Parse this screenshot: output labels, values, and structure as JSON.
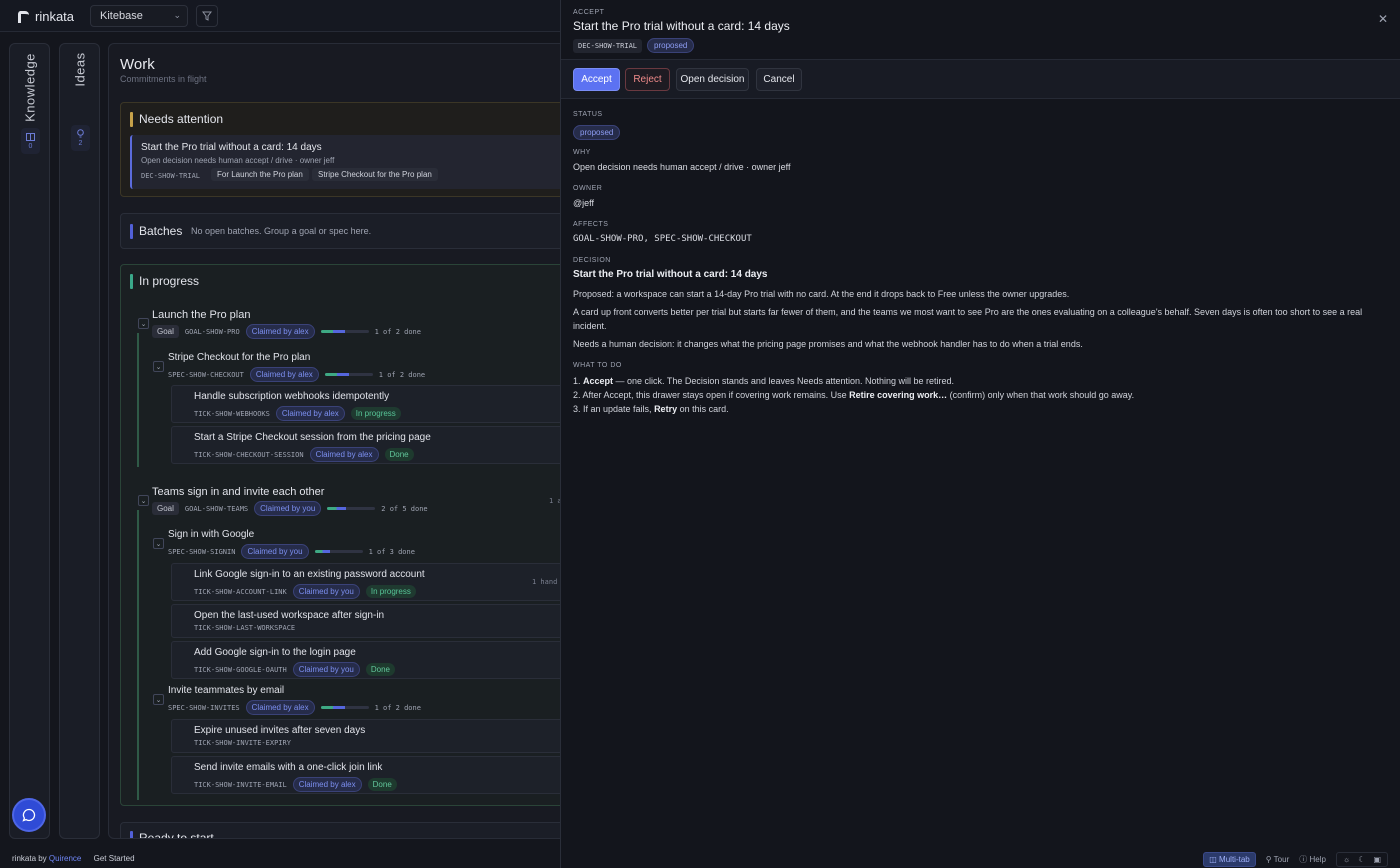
{
  "app": {
    "name": "rinkata",
    "workspace": "Kitebase"
  },
  "rails": {
    "knowledge": {
      "label": "Knowledge",
      "count": "0"
    },
    "ideas": {
      "label": "Ideas",
      "count": "2"
    }
  },
  "work": {
    "title": "Work",
    "subtitle": "Commitments in flight",
    "needs_attention": {
      "heading": "Needs attention",
      "card": {
        "title": "Start the Pro trial without a card: 14 days",
        "subtitle": "Open decision needs human accept / drive · owner jeff",
        "code": "DEC-SHOW-TRIAL",
        "chip_goal": "For Launch the Pro plan",
        "chip_spec": "Stripe Checkout for the Pro plan"
      }
    },
    "batches": {
      "heading": "Batches",
      "text": "No open batches. Group a goal or spec here."
    },
    "in_progress": {
      "heading": "In progress",
      "goal1": {
        "title": "Launch the Pro plan",
        "type": "Goal",
        "code": "GOAL-SHOW-PRO",
        "claim": "Claimed by alex",
        "progress_text": "1 of 2 done",
        "progress": 0.5,
        "spec": {
          "title": "Stripe Checkout for the Pro plan",
          "code": "SPEC-SHOW-CHECKOUT",
          "claim": "Claimed by alex",
          "progress_text": "1 of 2 done",
          "progress": 0.5,
          "t1": {
            "title": "Handle subscription webhooks idempotently",
            "code": "TICK-SHOW-WEBHOOKS",
            "claim": "Claimed by alex",
            "status": "In progress"
          },
          "t2": {
            "title": "Start a Stripe Checkout session from the pricing page",
            "code": "TICK-SHOW-CHECKOUT-SESSION",
            "claim": "Claimed by alex",
            "status": "Done"
          }
        }
      },
      "goal2": {
        "title": "Teams sign in and invite each other",
        "type": "Goal",
        "code": "GOAL-SHOW-TEAMS",
        "claim": "Claimed by you",
        "progress_text": "2 of 5 done",
        "progress": 0.4,
        "side": "1 a",
        "spec1": {
          "title": "Sign in with Google",
          "code": "SPEC-SHOW-SIGNIN",
          "claim": "Claimed by you",
          "progress_text": "1 of 3 done",
          "progress": 0.33,
          "t1": {
            "title": "Link Google sign-in to an existing password account",
            "code": "TICK-SHOW-ACCOUNT-LINK",
            "claim": "Claimed by you",
            "status": "In progress",
            "side": "1 hand"
          },
          "t2": {
            "title": "Open the last-used workspace after sign-in",
            "code": "TICK-SHOW-LAST-WORKSPACE"
          },
          "t3": {
            "title": "Add Google sign-in to the login page",
            "code": "TICK-SHOW-GOOGLE-OAUTH",
            "claim": "Claimed by you",
            "status": "Done"
          }
        },
        "spec2": {
          "title": "Invite teammates by email",
          "code": "SPEC-SHOW-INVITES",
          "claim": "Claimed by alex",
          "progress_text": "1 of 2 done",
          "progress": 0.5,
          "t1": {
            "title": "Expire unused invites after seven days",
            "code": "TICK-SHOW-INVITE-EXPIRY"
          },
          "t2": {
            "title": "Send invite emails with a one-click join link",
            "code": "TICK-SHOW-INVITE-EMAIL",
            "claim": "Claimed by alex",
            "status": "Done"
          }
        }
      }
    },
    "ready": {
      "heading": "Ready to start"
    }
  },
  "drawer": {
    "kicker": "ACCEPT",
    "title": "Start the Pro trial without a card: 14 days",
    "code": "DEC-SHOW-TRIAL",
    "status_pill": "proposed",
    "actions": {
      "accept": "Accept",
      "reject": "Reject",
      "open": "Open decision",
      "cancel": "Cancel"
    },
    "fields": {
      "status_label": "STATUS",
      "status_value": "proposed",
      "why_label": "WHY",
      "why_value": "Open decision needs human accept / drive · owner jeff",
      "owner_label": "OWNER",
      "owner_value": "@jeff",
      "affects_label": "AFFECTS",
      "affects_value": "GOAL-SHOW-PRO, SPEC-SHOW-CHECKOUT",
      "decision_label": "DECISION",
      "decision_title": "Start the Pro trial without a card: 14 days",
      "decision_p1": "Proposed: a workspace can start a 14-day Pro trial with no card. At the end it drops back to Free unless the owner upgrades.",
      "decision_p2": "A card up front converts better per trial but starts far fewer of them, and the teams we most want to see Pro are the ones evaluating on a colleague's behalf. Seven days is often too short to see a real incident.",
      "decision_p3": "Needs a human decision: it changes what the pricing page promises and what the webhook handler has to do when a trial ends.",
      "todo_label": "WHAT TO DO",
      "todo1_pre": "1. ",
      "todo1_bold": "Accept",
      "todo1_post": " — one click. The Decision stands and leaves Needs attention. Nothing will be retired.",
      "todo2_pre": "2. After Accept, this drawer stays open if covering work remains. Use ",
      "todo2_bold": "Retire covering work…",
      "todo2_post": " (confirm) only when that work should go away.",
      "todo3_pre": "3. If an update fails, ",
      "todo3_bold": "Retry",
      "todo3_post": " on this card."
    }
  },
  "footer": {
    "brand_prefix": "rinkata by",
    "brand": "Quirence",
    "get_started": "Get Started",
    "multitab": "Multi-tab",
    "tour": "Tour",
    "help": "Help"
  }
}
